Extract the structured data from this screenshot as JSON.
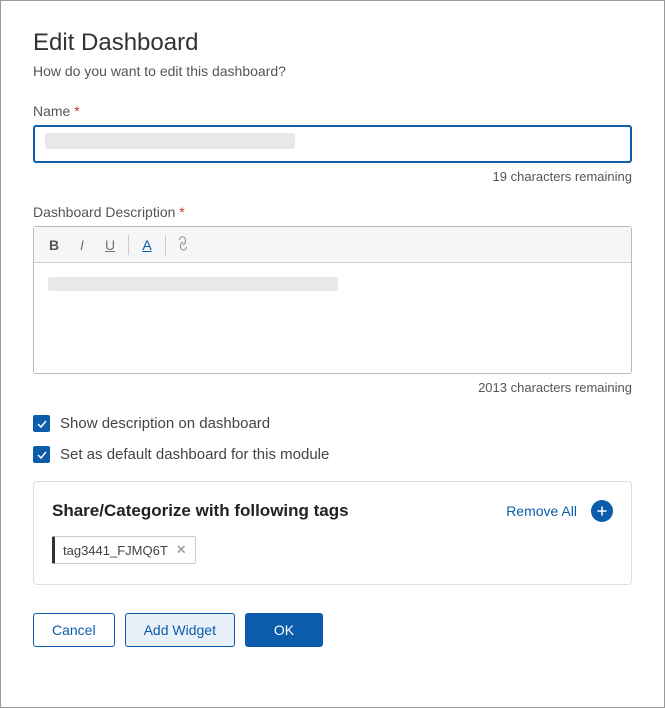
{
  "dialog": {
    "title": "Edit Dashboard",
    "subtitle": "How do you want to edit this dashboard?"
  },
  "name": {
    "label": "Name",
    "value": "",
    "remaining": "19 characters remaining"
  },
  "description": {
    "label": "Dashboard Description",
    "value": "",
    "remaining": "2013 characters remaining",
    "toolbar": {
      "bold": "B",
      "italic": "I",
      "underline": "U",
      "color": "A"
    }
  },
  "checkboxes": {
    "show_desc": {
      "label": "Show description on dashboard",
      "checked": true
    },
    "default_dash": {
      "label": "Set as default dashboard for this module",
      "checked": true
    }
  },
  "tags": {
    "title": "Share/Categorize with following tags",
    "remove_all": "Remove All",
    "items": [
      "tag3441_FJMQ6T"
    ]
  },
  "buttons": {
    "cancel": "Cancel",
    "add_widget": "Add Widget",
    "ok": "OK"
  }
}
